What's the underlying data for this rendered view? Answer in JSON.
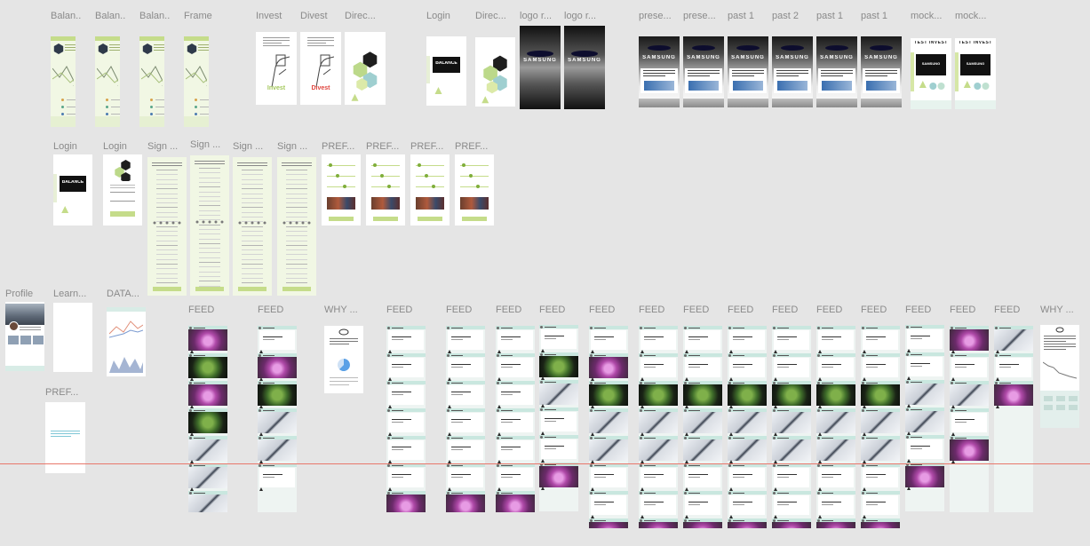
{
  "canvas": {
    "background": "#e5e5e5",
    "guide_color": "#e8776b",
    "palette": {
      "mint": "#f1f7e4",
      "lime": "#c5dc8a",
      "teal": "#d8ece6",
      "feed_bg": "#eef4f2",
      "black": "#111111",
      "white": "#ffffff"
    }
  },
  "frames": [
    {
      "label": "Balan...",
      "kind": "balance"
    },
    {
      "label": "Balan...",
      "kind": "balance"
    },
    {
      "label": "Balan...",
      "kind": "balance"
    },
    {
      "label": "Frame",
      "kind": "balance"
    },
    {
      "label": "Invest",
      "kind": "invest",
      "caption": "Invest"
    },
    {
      "label": "Divest",
      "kind": "invest",
      "caption": "Divest"
    },
    {
      "label": "Direc...",
      "kind": "direction"
    },
    {
      "label": "Login",
      "kind": "login_black",
      "brand": "BALANCE"
    },
    {
      "label": "Direc...",
      "kind": "direction"
    },
    {
      "label": "logo r...",
      "kind": "logo_grad",
      "brand": "SAMSUNG"
    },
    {
      "label": "logo r...",
      "kind": "logo_grad",
      "brand": "SAMSUNG"
    },
    {
      "label": "prese...",
      "kind": "pres",
      "brand": "SAMSUNG"
    },
    {
      "label": "prese...",
      "kind": "pres",
      "brand": "SAMSUNG"
    },
    {
      "label": "past 1",
      "kind": "pres",
      "brand": "SAMSUNG"
    },
    {
      "label": "past 2",
      "kind": "pres",
      "brand": "SAMSUNG"
    },
    {
      "label": "past 1",
      "kind": "pres",
      "brand": "SAMSUNG"
    },
    {
      "label": "past 1",
      "kind": "pres",
      "brand": "SAMSUNG"
    },
    {
      "label": "mock...",
      "kind": "mock",
      "title": "TEST INVEST",
      "brand": "SAMSUNG"
    },
    {
      "label": "mock...",
      "kind": "mock",
      "title": "TEST INVEST",
      "brand": "SAMSUNG"
    },
    {
      "label": "Login",
      "kind": "login_black",
      "brand": "BALANCE"
    },
    {
      "label": "Login",
      "kind": "login_form"
    },
    {
      "label": "Sign ...",
      "kind": "signup"
    },
    {
      "label": "Sign ...",
      "kind": "signup"
    },
    {
      "label": "Sign ...",
      "kind": "signup"
    },
    {
      "label": "Sign ...",
      "kind": "signup"
    },
    {
      "label": "PREF...",
      "kind": "pref"
    },
    {
      "label": "PREF...",
      "kind": "pref"
    },
    {
      "label": "PREF...",
      "kind": "pref"
    },
    {
      "label": "PREF...",
      "kind": "pref"
    },
    {
      "label": "Profile",
      "kind": "profile"
    },
    {
      "label": "Learn...",
      "kind": "blank"
    },
    {
      "label": "DATA...",
      "kind": "data"
    },
    {
      "label": "PREF...",
      "kind": "pref_small"
    },
    {
      "label": "FEED",
      "kind": "feed",
      "seq": "fsfsnnnt"
    },
    {
      "label": "FEED",
      "kind": "feed",
      "seq": "tfsnnt"
    },
    {
      "label": "WHY ...",
      "kind": "why"
    },
    {
      "label": "FEED",
      "kind": "feed",
      "seq": "ttttttf"
    },
    {
      "label": "FEED",
      "kind": "feed",
      "seq": "ttttttf"
    },
    {
      "label": "FEED",
      "kind": "feed",
      "seq": "ttttttf"
    },
    {
      "label": "FEED",
      "kind": "feed",
      "seq": "tsnttf"
    },
    {
      "label": "FEED",
      "kind": "feed",
      "seq": "tfsnnttff"
    },
    {
      "label": "FEED",
      "kind": "feed",
      "seq": "ttsnnttff"
    },
    {
      "label": "FEED",
      "kind": "feed",
      "seq": "ttsnnttff"
    },
    {
      "label": "FEED",
      "kind": "feed",
      "seq": "ttsnnttff"
    },
    {
      "label": "FEED",
      "kind": "feed",
      "seq": "ttsnnttff"
    },
    {
      "label": "FEED",
      "kind": "feed",
      "seq": "ttsnnttff"
    },
    {
      "label": "FEED",
      "kind": "feed",
      "seq": "ttsnnttff"
    },
    {
      "label": "FEED",
      "kind": "feed",
      "seq": "ttnntf"
    },
    {
      "label": "FEED",
      "kind": "feed",
      "seq": "ftntf"
    },
    {
      "label": "FEED",
      "kind": "feed",
      "seq": "ntf"
    },
    {
      "label": "WHY ...",
      "kind": "why_chart"
    }
  ]
}
